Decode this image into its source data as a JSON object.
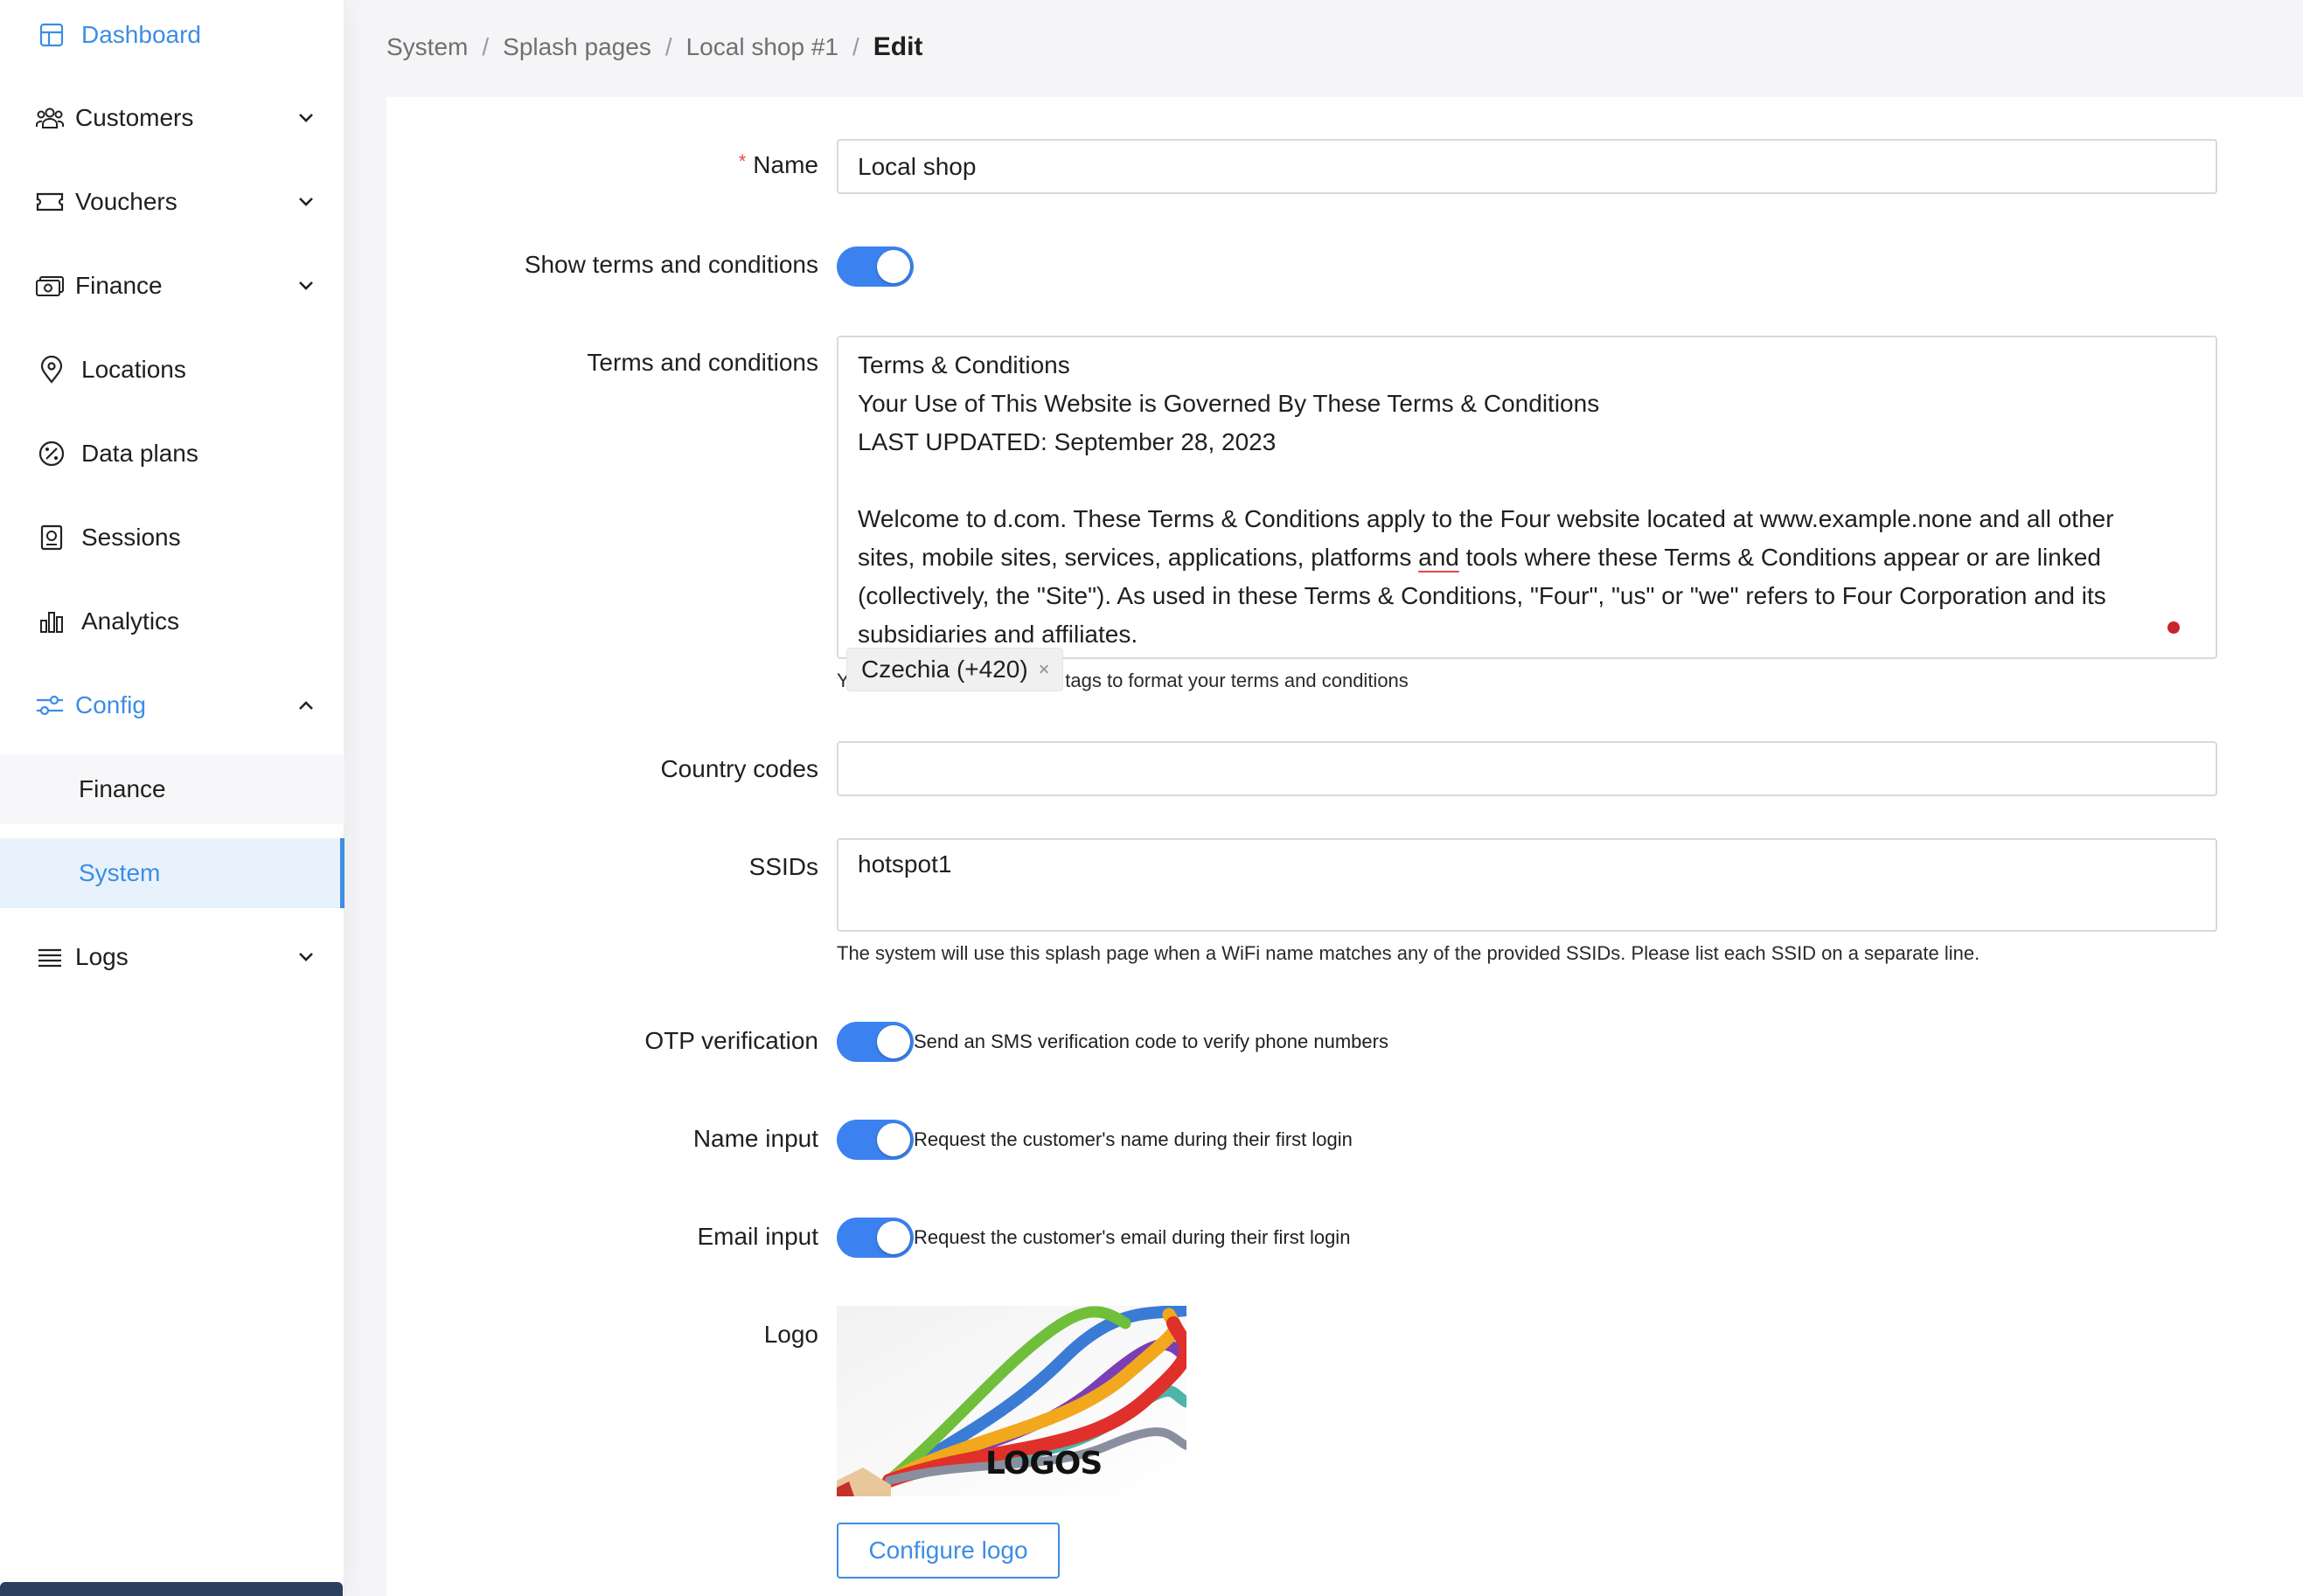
{
  "sidebar": {
    "items": [
      {
        "label": "Dashboard",
        "icon": "dashboard-icon"
      },
      {
        "label": "Customers",
        "icon": "customers-icon"
      },
      {
        "label": "Vouchers",
        "icon": "voucher-icon"
      },
      {
        "label": "Finance",
        "icon": "finance-icon"
      },
      {
        "label": "Locations",
        "icon": "location-pin-icon"
      },
      {
        "label": "Data plans",
        "icon": "percent-icon"
      },
      {
        "label": "Sessions",
        "icon": "sessions-icon"
      },
      {
        "label": "Analytics",
        "icon": "bar-chart-icon"
      },
      {
        "label": "Config",
        "icon": "sliders-icon"
      },
      {
        "label": "Logs",
        "icon": "list-icon"
      }
    ],
    "config_children": [
      {
        "label": "Finance"
      },
      {
        "label": "System"
      }
    ],
    "accent_color": "#3d8de3"
  },
  "breadcrumb": {
    "items": [
      "System",
      "Splash pages",
      "Local shop #1"
    ],
    "current": "Edit"
  },
  "form": {
    "name": {
      "label": "Name",
      "required_mark": "*",
      "value": "Local shop"
    },
    "show_terms": {
      "label": "Show terms and conditions",
      "enabled": true
    },
    "terms": {
      "label": "Terms and conditions",
      "lines": [
        "Terms & Conditions",
        "Your Use of This Website is Governed By These Terms & Conditions",
        "LAST UPDATED: September 28, 2023",
        "",
        "Welcome to d.com. These Terms & Conditions apply to the Four website located at www.example.none and all other",
        "sites, mobile sites, services, applications, platforms",
        "and",
        " tools where these Terms & Conditions appear or are linked",
        "(collectively, the \"Site\"). As used in these Terms & Conditions, \"Four\", \"us\" or \"we\" refers to Four Corporation and its",
        "subsidiaries and affiliates."
      ],
      "help": "You can use simple HTML tags to format your terms and conditions"
    },
    "country_codes": {
      "label": "Country codes",
      "tags": [
        "Czechia (+420)"
      ],
      "remove_symbol": "×"
    },
    "ssids": {
      "label": "SSIDs",
      "value": "hotspot1",
      "help": "The system will use this splash page when a WiFi name matches any of the provided SSIDs. Please list each SSID on a separate line."
    },
    "otp": {
      "label": "OTP verification",
      "enabled": true,
      "description": "Send an SMS verification code to verify phone numbers"
    },
    "name_input": {
      "label": "Name input",
      "enabled": true,
      "description": "Request the customer's name during their first login"
    },
    "email_input": {
      "label": "Email input",
      "enabled": true,
      "description": "Request the customer's email during their first login"
    },
    "logo": {
      "label": "Logo",
      "image_text": "LOGOS",
      "button_label": "Configure logo"
    }
  },
  "colors": {
    "toggle_on": "#3b82f0",
    "required": "#e5484d"
  }
}
